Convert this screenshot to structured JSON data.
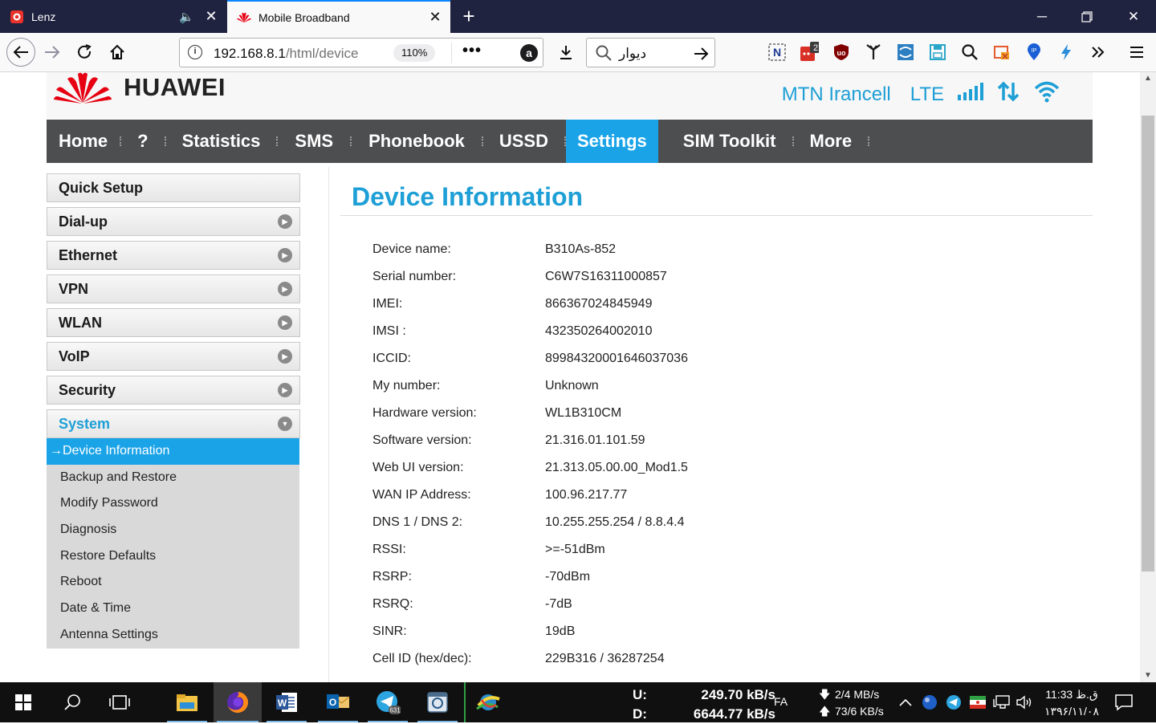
{
  "browser": {
    "tabs": [
      {
        "title": "Lenz",
        "favicon": "lenz-icon",
        "extra": "🔈"
      },
      {
        "title": "Mobile Broadband",
        "favicon": "huawei-icon"
      }
    ],
    "url_host": "192.168.8.1",
    "url_path": "/html/device",
    "zoom": "110%",
    "more_label": "•••",
    "search_text": "دیوار"
  },
  "brand": {
    "name": "HUAWEI",
    "color": "#e60012"
  },
  "status": {
    "operator": "MTN Irancell",
    "network": "LTE"
  },
  "nav": {
    "items": [
      "Home",
      "?",
      "Statistics",
      "SMS",
      "Phonebook",
      "USSD",
      "Settings",
      "SIM Toolkit",
      "More"
    ],
    "selected": "Settings",
    "accent": "#1ba3e8"
  },
  "sidebar": {
    "items": [
      "Quick Setup",
      "Dial-up",
      "Ethernet",
      "VPN",
      "WLAN",
      "VoIP",
      "Security",
      "System"
    ],
    "system_sub": [
      "→Device Information",
      "Backup and Restore",
      "Modify Password",
      "Diagnosis",
      "Restore Defaults",
      "Reboot",
      "Date & Time",
      "Antenna Settings"
    ]
  },
  "content": {
    "title": "Device Information",
    "rows": [
      {
        "label": "Device name:",
        "value": "B310As-852"
      },
      {
        "label": "Serial number:",
        "value": "C6W7S16311000857"
      },
      {
        "label": "IMEI:",
        "value": "866367024845949"
      },
      {
        "label": "IMSI :",
        "value": "432350264002010"
      },
      {
        "label": "ICCID:",
        "value": "89984320001646037036"
      },
      {
        "label": "My number:",
        "value": "Unknown"
      },
      {
        "label": "Hardware version:",
        "value": "WL1B310CM"
      },
      {
        "label": "Software version:",
        "value": "21.316.01.101.59"
      },
      {
        "label": "Web UI version:",
        "value": "21.313.05.00.00_Mod1.5"
      },
      {
        "label": "WAN IP Address:",
        "value": "100.96.217.77"
      },
      {
        "label": "DNS 1 / DNS 2:",
        "value": "10.255.255.254 / 8.8.4.4"
      },
      {
        "label": "RSSI:",
        "value": ">=-51dBm"
      },
      {
        "label": "RSRP:",
        "value": "-70dBm"
      },
      {
        "label": "RSRQ:",
        "value": "-7dB"
      },
      {
        "label": "SINR:",
        "value": "19dB"
      },
      {
        "label": "Cell ID (hex/dec):",
        "value": "229B316 / 36287254"
      }
    ]
  },
  "taskbar": {
    "upload_label": "U:",
    "upload_value": "249.70 kB/s",
    "download_label": "D:",
    "download_value": "6644.77 kB/s",
    "language": "FA",
    "net_down": "2/4 MB/s",
    "net_up": "73/6 KB/s",
    "telegram_badge": "631",
    "time": "11:33 ق.ظ",
    "date": "۱۳۹۶/۱۱/۰۸"
  },
  "extension_badge": "2"
}
